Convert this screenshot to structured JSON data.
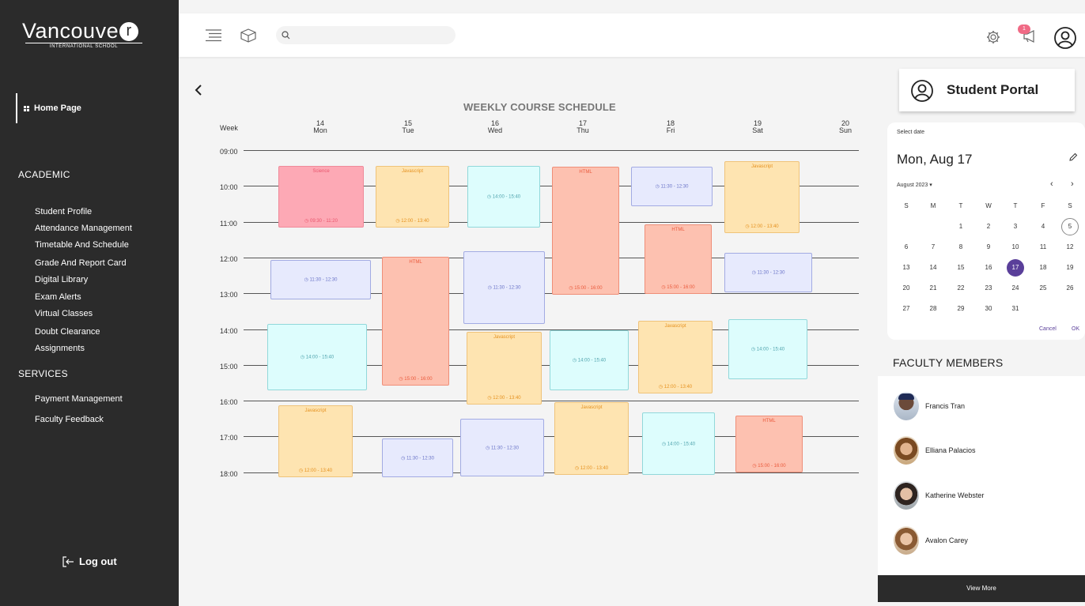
{
  "brand": {
    "name": "Vancouve",
    "letter": "r",
    "subtitle": "INTERNATIONAL SCHOOL"
  },
  "sidebar": {
    "home": "Home Page",
    "academic_title": "ACADEMIC",
    "academic_items": [
      "Student Profile",
      "Attendance Management",
      "Timetable And Schedule",
      "Grade And Report Card",
      "Digital Library",
      "Exam Alerts",
      "Virtual Classes",
      "Doubt Clearance",
      "Assignments"
    ],
    "services_title": "SERVICES",
    "services_items": [
      "Payment Management",
      "Faculty Feedback"
    ],
    "logout": "Log out"
  },
  "topbar": {
    "search_placeholder": "",
    "notification_count": "1"
  },
  "schedule": {
    "title": "WEEKLY COURSE SCHEDULE",
    "week_label": "Week",
    "days": [
      {
        "num": "14",
        "name": "Mon"
      },
      {
        "num": "15",
        "name": "Tue"
      },
      {
        "num": "16",
        "name": "Wed"
      },
      {
        "num": "17",
        "name": "Thu"
      },
      {
        "num": "18",
        "name": "Fri"
      },
      {
        "num": "19",
        "name": "Sat"
      },
      {
        "num": "20",
        "name": "Sun"
      }
    ],
    "hours": [
      "09:00",
      "10:00",
      "11:00",
      "12:00",
      "13:00",
      "14:00",
      "15:00",
      "16:00",
      "17:00",
      "18:00"
    ],
    "events": [
      {
        "day": "Mon",
        "title": "Science",
        "time": "09:30 - 11:20",
        "color": "pink"
      },
      {
        "day": "Mon",
        "title": "",
        "time": "11:30 - 12:30",
        "color": "lav"
      },
      {
        "day": "Mon",
        "title": "",
        "time": "14:00 - 15:40",
        "color": "cyan"
      },
      {
        "day": "Mon",
        "title": "Javascript",
        "time": "12:00 - 13:40",
        "color": "orange"
      },
      {
        "day": "Tue",
        "title": "Javascript",
        "time": "12:00 - 13:40",
        "color": "orange"
      },
      {
        "day": "Tue",
        "title": "HTML",
        "time": "15:00 - 16:00",
        "color": "salmon"
      },
      {
        "day": "Tue",
        "title": "",
        "time": "11:30 - 12:30",
        "color": "lav"
      },
      {
        "day": "Wed",
        "title": "",
        "time": "14:00 - 15:40",
        "color": "cyan"
      },
      {
        "day": "Wed",
        "title": "",
        "time": "11:30 - 12:30",
        "color": "lav"
      },
      {
        "day": "Wed",
        "title": "Javascript",
        "time": "12:00 - 13:40",
        "color": "orange"
      },
      {
        "day": "Wed",
        "title": "",
        "time": "11:30 - 12:30",
        "color": "lav"
      },
      {
        "day": "Thu",
        "title": "HTML",
        "time": "15:00 - 16:00",
        "color": "salmon"
      },
      {
        "day": "Thu",
        "title": "",
        "time": "14:00 - 15:40",
        "color": "cyan"
      },
      {
        "day": "Thu",
        "title": "Javascript",
        "time": "12:00 - 13:40",
        "color": "orange"
      },
      {
        "day": "Fri",
        "title": "",
        "time": "11:30 - 12:30",
        "color": "lav"
      },
      {
        "day": "Fri",
        "title": "HTML",
        "time": "15:00 - 16:00",
        "color": "salmon"
      },
      {
        "day": "Fri",
        "title": "Javascript",
        "time": "12:00 - 13:40",
        "color": "orange"
      },
      {
        "day": "Fri",
        "title": "",
        "time": "14:00 - 15:40",
        "color": "cyan"
      },
      {
        "day": "Sat",
        "title": "Javascript",
        "time": "12:00 - 13:40",
        "color": "orange"
      },
      {
        "day": "Sat",
        "title": "",
        "time": "11:30 - 12:30",
        "color": "lav"
      },
      {
        "day": "Sat",
        "title": "",
        "time": "14:00 - 15:40",
        "color": "cyan"
      },
      {
        "day": "Sat",
        "title": "HTML",
        "time": "15:00 - 16:00",
        "color": "salmon"
      }
    ]
  },
  "portal": {
    "label": "Student Portal"
  },
  "calendar": {
    "select_label": "Select date",
    "selected_date": "Mon, Aug 17",
    "month_label": "August 2023",
    "weekday_headers": [
      "S",
      "M",
      "T",
      "W",
      "T",
      "F",
      "S"
    ],
    "days": [
      "1",
      "2",
      "3",
      "4",
      "5",
      "6",
      "7",
      "8",
      "9",
      "10",
      "11",
      "12",
      "13",
      "14",
      "15",
      "16",
      "17",
      "18",
      "19",
      "20",
      "21",
      "22",
      "23",
      "24",
      "25",
      "26",
      "27",
      "28",
      "29",
      "30",
      "31"
    ],
    "today": "5",
    "selected": "17",
    "cancel": "Cancel",
    "ok": "OK",
    "accent_color": "#5a3f9a"
  },
  "faculty": {
    "title": "FACULTY MEMBERS",
    "members": [
      "Francis Tran",
      "Elliana Palacios",
      "Katherine Webster",
      "Avalon Carey"
    ],
    "view_more": "View More"
  }
}
